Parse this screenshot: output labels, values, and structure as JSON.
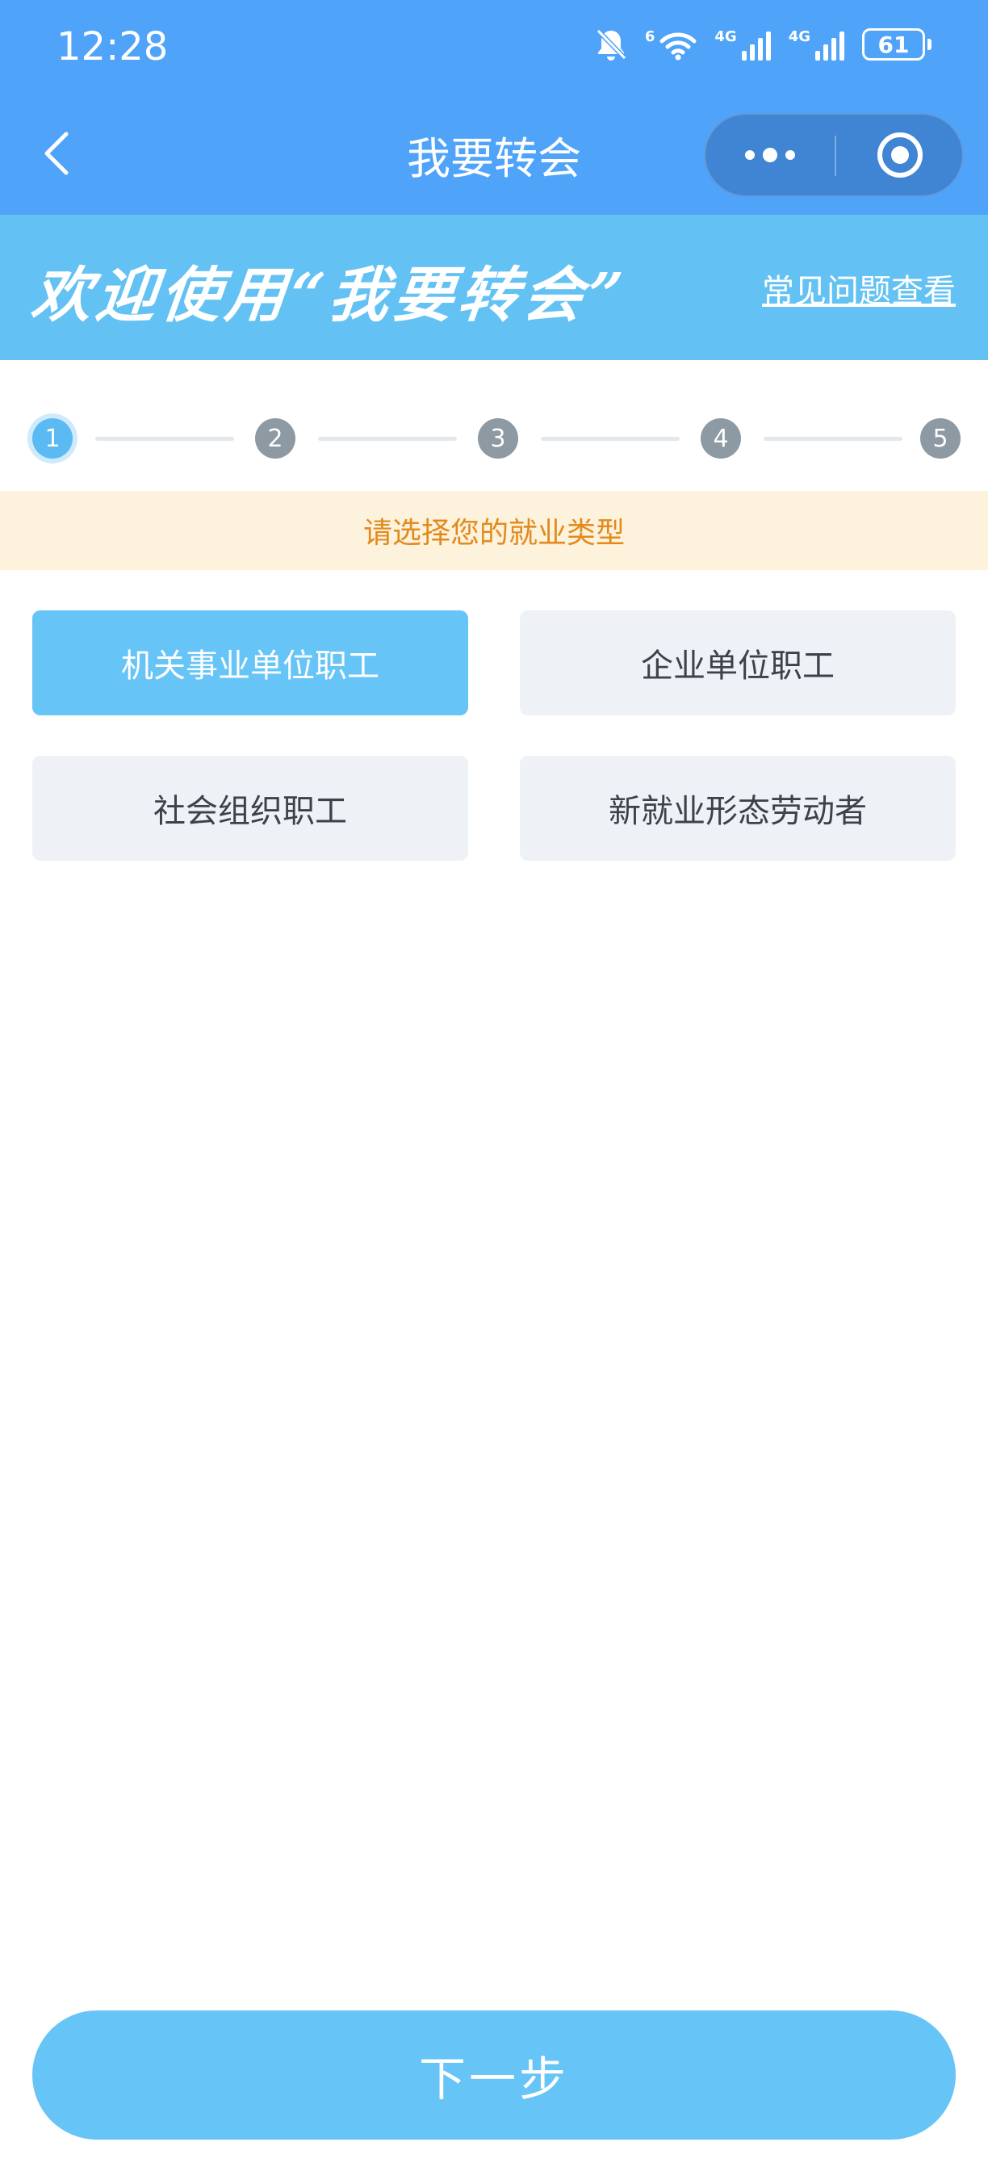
{
  "status_bar": {
    "time": "12:28",
    "icons": [
      "bell-off-icon",
      "wifi-icon",
      "signal-icon",
      "signal-icon",
      "battery-icon"
    ],
    "wifi_tag": "6",
    "signal1_tag": "4G",
    "signal2_tag": "4G",
    "battery": "61"
  },
  "nav": {
    "title": "我要转会",
    "back_icon": "chevron-left-icon",
    "more_icon": "more-dots-icon",
    "close_icon": "target-icon"
  },
  "banner": {
    "welcome": "欢迎使用“我要转会”",
    "faq_link": "常见问题查看"
  },
  "steps": {
    "items": [
      "1",
      "2",
      "3",
      "4",
      "5"
    ],
    "current": 1
  },
  "hint": "请选择您的就业类型",
  "options": [
    {
      "label": "机关事业单位职工",
      "selected": true
    },
    {
      "label": "企业单位职工",
      "selected": false
    },
    {
      "label": "社会组织职工",
      "selected": false
    },
    {
      "label": "新就业形态劳动者",
      "selected": false
    }
  ],
  "colors": {
    "header": "#4FA3F9",
    "banner": "#63C2F3",
    "accent": "#67C4F6",
    "hint_bg": "#FDF2DB",
    "hint_text": "#E28A1D"
  },
  "next_button": "下一步"
}
